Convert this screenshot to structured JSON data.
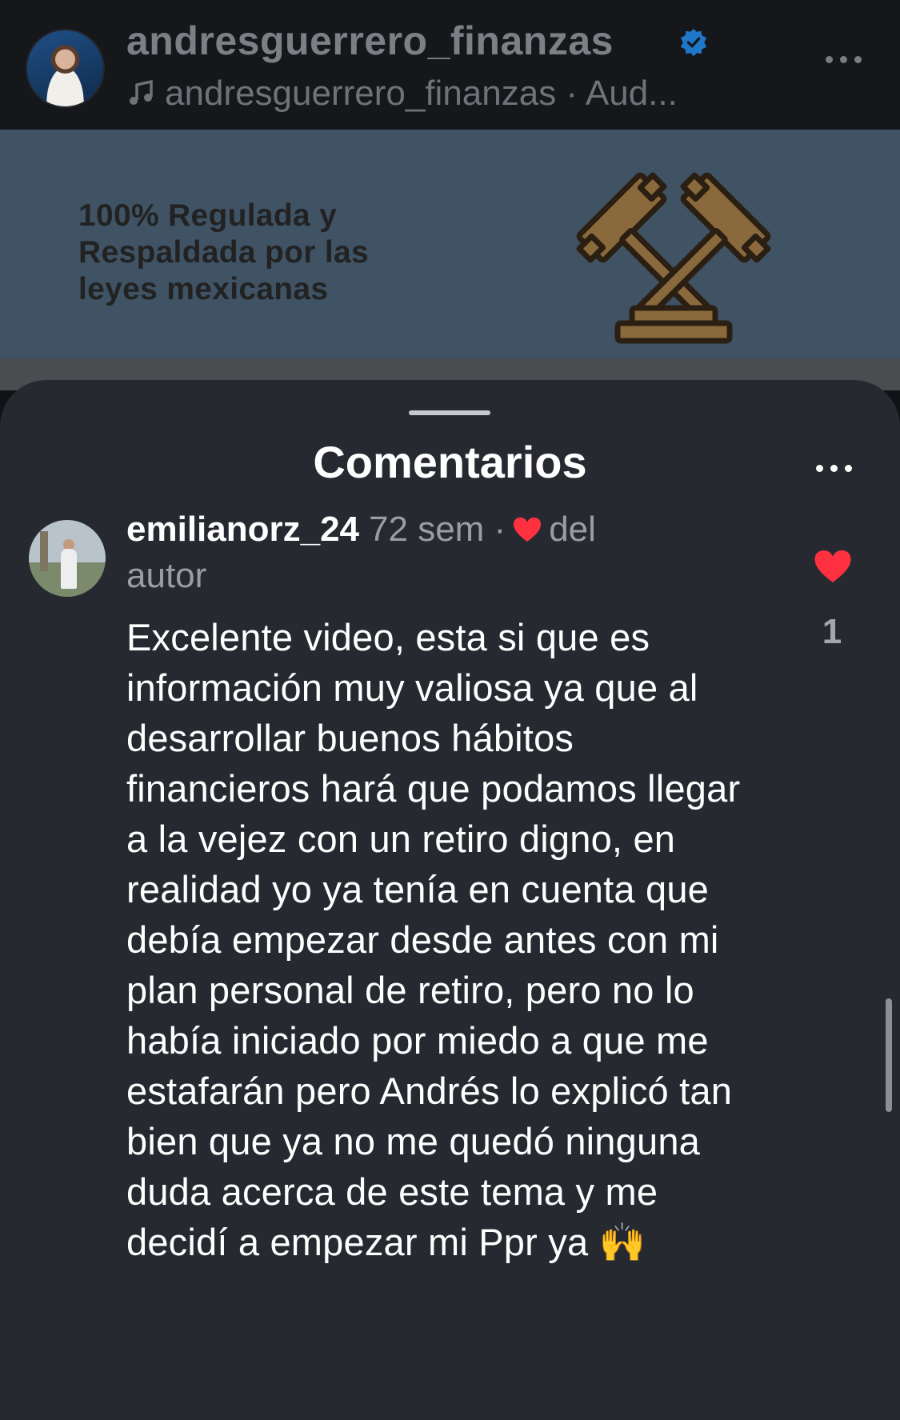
{
  "header": {
    "username": "andresguerrero_finanzas",
    "audio_label": "andresguerrero_finanzas · Aud..."
  },
  "banner": {
    "lines": [
      "100% Regulada y",
      "Respaldada por las",
      "leyes mexicanas"
    ]
  },
  "comments_sheet": {
    "title": "Comentarios"
  },
  "comment": {
    "username": "emilianorz_24",
    "time": "72 sem ·",
    "author_liked_prefix": "del",
    "author_liked_suffix": "autor",
    "text": "Excelente video, esta si que es información muy valiosa ya que al desarrollar buenos hábitos financieros hará que podamos llegar a la vejez con un retiro digno, en realidad yo ya tenía en cuenta que debía empezar desde antes con mi plan personal de retiro, pero no lo había iniciado por miedo a que me estafarán pero Andrés lo explicó tan bien que ya no me quedó ninguna duda acerca de este tema y me decidí a empezar mi Ppr ya 🙌",
    "like_count": "1"
  },
  "colors": {
    "like_red": "#ff3040",
    "verified_blue": "#1f77c9",
    "banner_bg": "#3f5365",
    "sheet_bg": "#262a30"
  }
}
